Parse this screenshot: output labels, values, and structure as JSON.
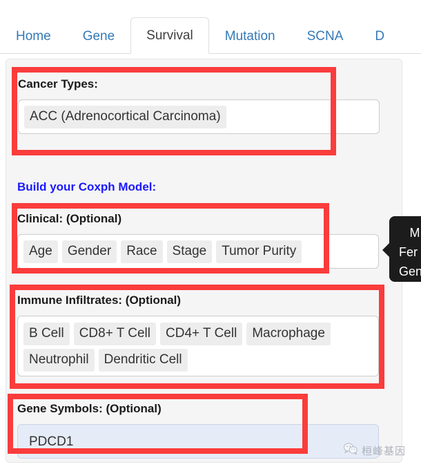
{
  "nav": {
    "tabs": [
      {
        "label": "Home",
        "active": false
      },
      {
        "label": "Gene",
        "active": false
      },
      {
        "label": "Survival",
        "active": true
      },
      {
        "label": "Mutation",
        "active": false
      },
      {
        "label": "SCNA",
        "active": false
      },
      {
        "label": "D",
        "active": false
      }
    ]
  },
  "form": {
    "cancer_types": {
      "label": "Cancer Types:",
      "selected": [
        "ACC (Adrenocortical Carcinoma)"
      ]
    },
    "build_model_label": "Build your Coxph Model:",
    "clinical": {
      "label": "Clinical: (Optional)",
      "selected": [
        "Age",
        "Gender",
        "Race",
        "Stage",
        "Tumor Purity"
      ]
    },
    "immune_infiltrates": {
      "label": "Immune Infiltrates: (Optional)",
      "selected": [
        "B Cell",
        "CD8+ T Cell",
        "CD4+ T Cell",
        "Macrophage",
        "Neutrophil",
        "Dendritic Cell"
      ]
    },
    "gene_symbols": {
      "label": "Gene Symbols: (Optional)",
      "value": "PDCD1"
    }
  },
  "tooltip": {
    "lines": [
      "M",
      "Fer",
      "Gen"
    ]
  },
  "watermark": {
    "text": "桓峰基因",
    "icon": "wechat-icon"
  },
  "colors": {
    "annotation": "#fa3c3c",
    "link": "#337ab7",
    "heading_blue": "#1a1aff",
    "panel_bg": "#f5f5f5",
    "tooltip_bg": "#1c1c1c"
  }
}
